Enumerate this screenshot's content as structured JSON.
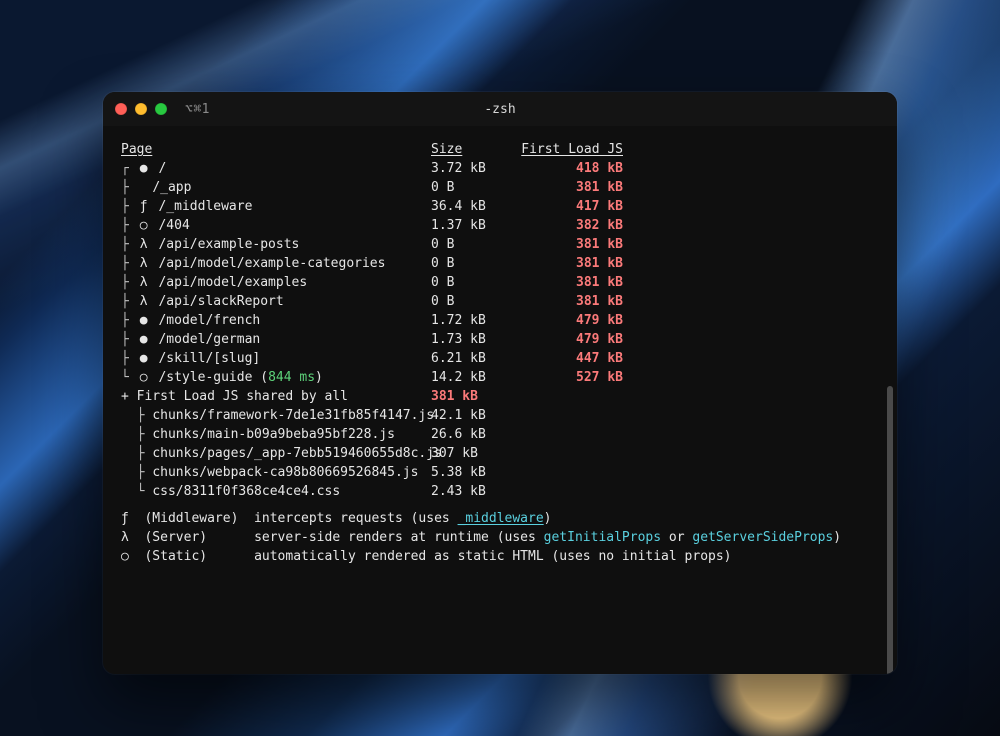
{
  "window": {
    "tab_shortcut": "⌥⌘1",
    "title": "-zsh"
  },
  "headers": {
    "page": "Page",
    "size": "Size",
    "first_load": "First Load JS"
  },
  "routes": [
    {
      "tree": "┌ ",
      "sym": "●",
      "path": "/",
      "size": "3.72 kB",
      "first": "418 kB"
    },
    {
      "tree": "├   ",
      "sym": "",
      "path": "/_app",
      "size": "0 B",
      "first": "381 kB"
    },
    {
      "tree": "├ ",
      "sym": "ƒ",
      "path": "/_middleware",
      "size": "36.4 kB",
      "first": "417 kB"
    },
    {
      "tree": "├ ",
      "sym": "○",
      "path": "/404",
      "size": "1.37 kB",
      "first": "382 kB"
    },
    {
      "tree": "├ ",
      "sym": "λ",
      "path": "/api/example-posts",
      "size": "0 B",
      "first": "381 kB"
    },
    {
      "tree": "├ ",
      "sym": "λ",
      "path": "/api/model/example-categories",
      "size": "0 B",
      "first": "381 kB"
    },
    {
      "tree": "├ ",
      "sym": "λ",
      "path": "/api/model/examples",
      "size": "0 B",
      "first": "381 kB"
    },
    {
      "tree": "├ ",
      "sym": "λ",
      "path": "/api/slackReport",
      "size": "0 B",
      "first": "381 kB"
    },
    {
      "tree": "├ ",
      "sym": "●",
      "path": "/model/french",
      "size": "1.72 kB",
      "first": "479 kB"
    },
    {
      "tree": "├ ",
      "sym": "●",
      "path": "/model/german",
      "size": "1.73 kB",
      "first": "479 kB"
    },
    {
      "tree": "├ ",
      "sym": "●",
      "path": "/skill/[slug]",
      "size": "6.21 kB",
      "first": "447 kB"
    },
    {
      "tree": "└ ",
      "sym": "○",
      "path": "/style-guide",
      "extra": " (",
      "extra_time": "844 ms",
      "extra_close": ")",
      "size": "14.2 kB",
      "first": "527 kB"
    }
  ],
  "shared": {
    "label": "+ First Load JS shared by all",
    "total": "381 kB",
    "chunks": [
      {
        "tree": "  ├ ",
        "name": "chunks/framework-7de1e31fb85f4147.js",
        "size": "42.1 kB"
      },
      {
        "tree": "  ├ ",
        "name": "chunks/main-b09a9beba95bf228.js",
        "size": "26.6 kB"
      },
      {
        "tree": "  ├ ",
        "name": "chunks/pages/_app-7ebb519460655d8c.js",
        "size": "307 kB"
      },
      {
        "tree": "  ├ ",
        "name": "chunks/webpack-ca98b80669526845.js",
        "size": "5.38 kB"
      },
      {
        "tree": "  └ ",
        "name": "css/8311f0f368ce4ce4.css",
        "size": "2.43 kB"
      }
    ]
  },
  "legend": {
    "mw_sym": "ƒ",
    "mw_label": "(Middleware)",
    "mw_text": "  intercepts requests (uses ",
    "mw_link": "_middleware",
    "mw_close": ")",
    "srv_sym": "λ",
    "srv_label": "(Server)",
    "srv_text": "      server-side renders at runtime (uses ",
    "srv_link1": "getInitialProps",
    "srv_or": " or ",
    "srv_link2": "getServerSideProps",
    "srv_close": ")",
    "st_sym": "○",
    "st_label": "(Static)",
    "st_text": "      automatically rendered as static HTML (uses no initial props)"
  }
}
